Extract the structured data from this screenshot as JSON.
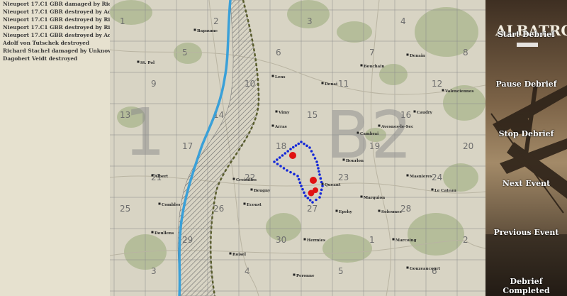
{
  "event_log": [
    "Nieuport 17.C1 GBR damaged by Richard Sta",
    "Nieuport 17.C1 GBR destroyed by Adolf von",
    "Nieuport 17.C1 GBR destroyed by Richard Sta",
    "Nieuport 17.C1 GBR destroyed by Richard Sta",
    "Nieuport 17.C1 GBR destroyed by Adolf von",
    "Adolf von Tutschek destroyed",
    "Richard Stachel damaged by Unknown",
    "Dagobert Veidt destroyed"
  ],
  "map": {
    "big_labels": [
      "1",
      "B2"
    ],
    "grid_numbers": [
      "1",
      "2",
      "3",
      "4",
      "5",
      "6",
      "7",
      "8",
      "9",
      "10",
      "11",
      "12",
      "13",
      "14",
      "15",
      "16",
      "17",
      "18",
      "19",
      "20",
      "21",
      "22",
      "23",
      "24",
      "25",
      "26",
      "27",
      "28",
      "29",
      "30"
    ],
    "towns": [
      "Bapaume",
      "Arras",
      "Cambrai",
      "Douai",
      "Lens",
      "Albert",
      "Peronne",
      "St. Pol",
      "Doullens",
      "Avesnes-le-Sec",
      "Vimy",
      "Croisilles",
      "Ecoust",
      "Queant",
      "Marquion",
      "Bourlon",
      "Masnieres",
      "Caudry",
      "Le Cateau",
      "Solesmes",
      "Valenciennes",
      "Denain",
      "Bouchain",
      "Marcoing",
      "Gouzeaucourt",
      "Epehy",
      "Roisel",
      "Combles",
      "Beugny",
      "Hermies"
    ]
  },
  "controls": {
    "brand": "ALBATROS",
    "start": "Start Debrief",
    "pause": "Pause Debrief",
    "stop": "Stop Debrief",
    "next": "Next Event",
    "previous": "Previous Event",
    "completed": "Debrief Completed"
  },
  "colors": {
    "log_bg": "#e6e1cf",
    "river": "#3aa0d8",
    "front_line": "#5a5e2e",
    "flight_path": "#1428d8",
    "event_marker": "#e01212"
  }
}
